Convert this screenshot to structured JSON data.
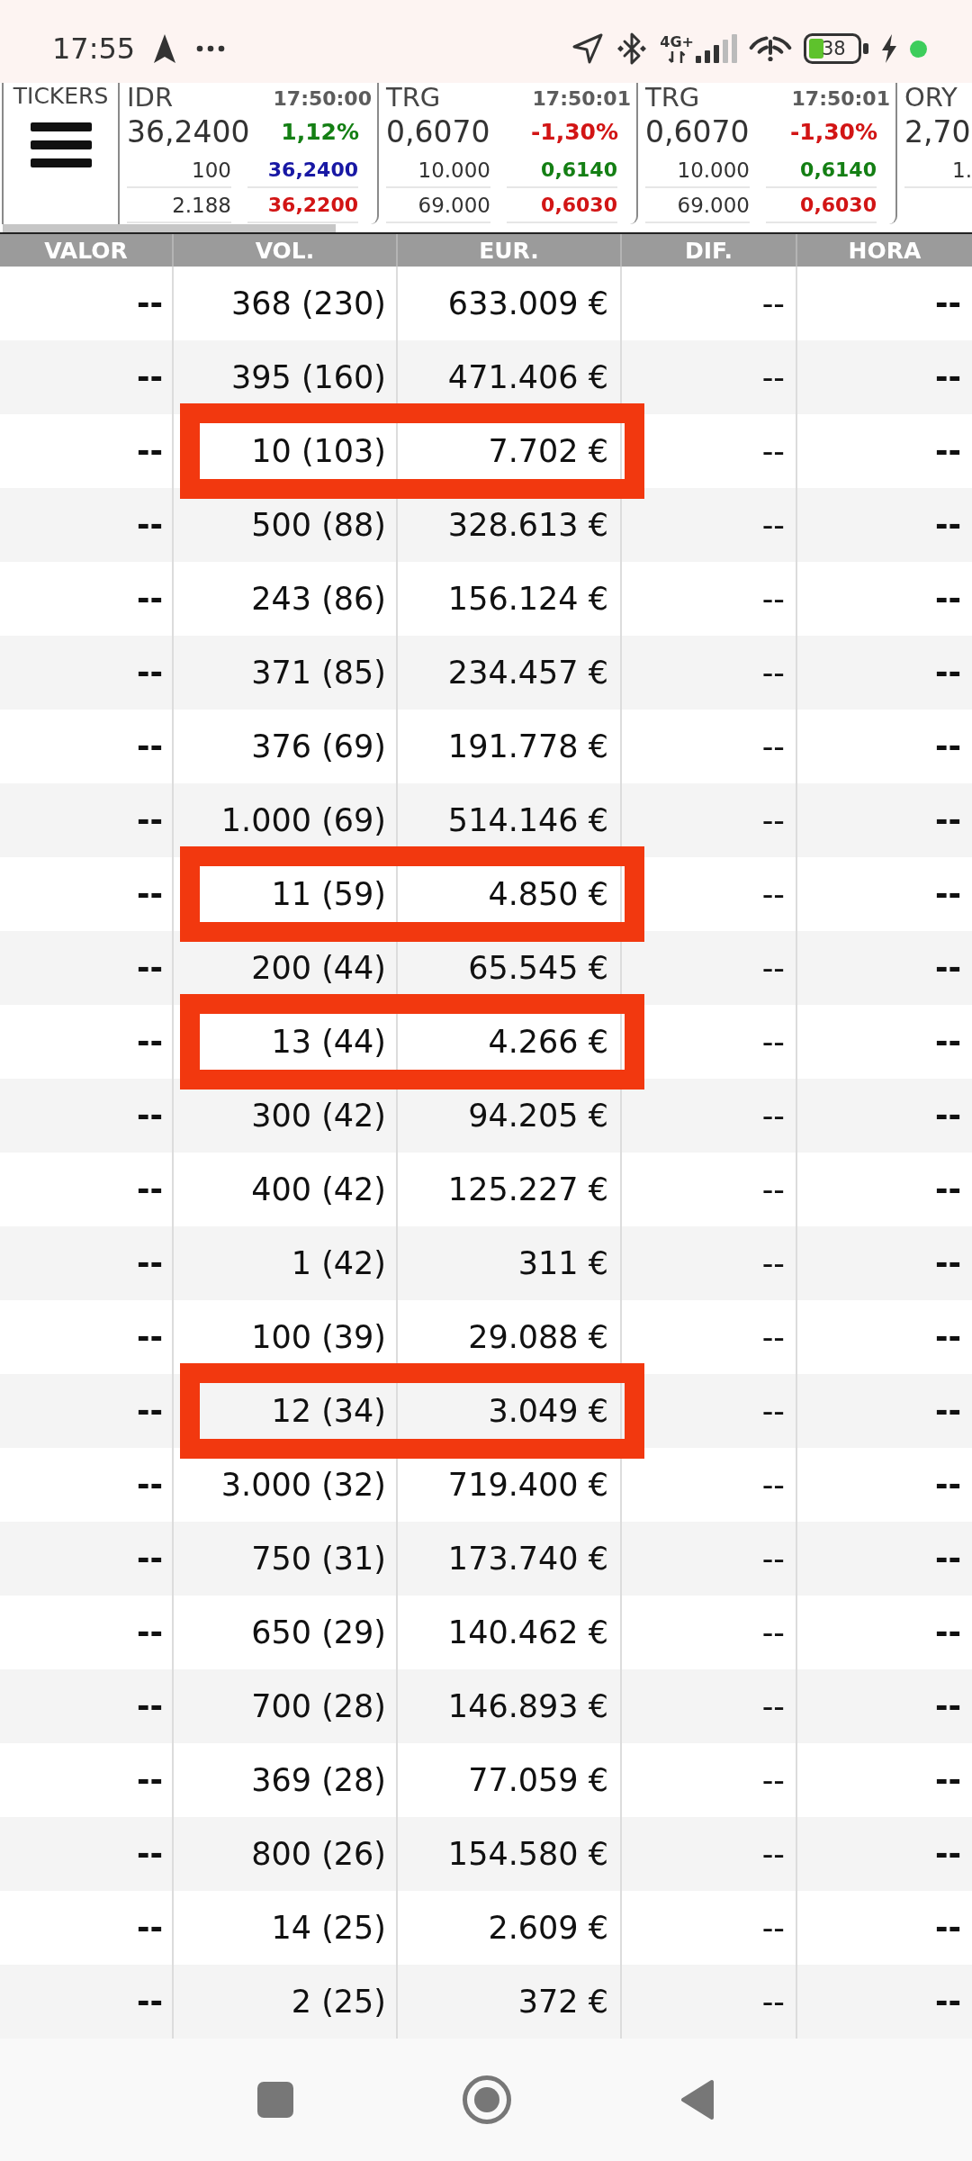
{
  "status_bar": {
    "time": "17:55",
    "network": "4G+",
    "battery": "38"
  },
  "tickers": {
    "label": "TICKERS",
    "items": [
      {
        "symbol": "IDR",
        "time": "17:50:00",
        "price": "36,2400",
        "change": {
          "text": "1,12%",
          "color": "#147f14"
        },
        "quotes": [
          {
            "volume": "100",
            "price": "36,2400",
            "color": "#1818a4"
          },
          {
            "volume": "2.188",
            "price": "36,2200",
            "color": "#d21515"
          }
        ]
      },
      {
        "symbol": "TRG",
        "time": "17:50:01",
        "price": "0,6070",
        "change": {
          "text": "-1,30%",
          "color": "#d21515"
        },
        "quotes": [
          {
            "volume": "10.000",
            "price": "0,6140",
            "color": "#147f14"
          },
          {
            "volume": "69.000",
            "price": "0,6030",
            "color": "#d21515"
          }
        ]
      },
      {
        "symbol": "TRG",
        "time": "17:50:01",
        "price": "0,6070",
        "change": {
          "text": "-1,30%",
          "color": "#d21515"
        },
        "quotes": [
          {
            "volume": "10.000",
            "price": "0,6140",
            "color": "#147f14"
          },
          {
            "volume": "69.000",
            "price": "0,6030",
            "color": "#d21515"
          }
        ]
      },
      {
        "symbol": "ORY",
        "price": "2,70",
        "quotes": [
          {
            "volume": "1."
          }
        ]
      }
    ]
  },
  "table": {
    "columns": [
      "VALOR",
      "VOL.",
      "EUR.",
      "DIF.",
      "HORA"
    ],
    "rows": [
      {
        "cells": [
          "--",
          "368 (230)",
          "633.009 €",
          "--",
          "--"
        ],
        "highlighted": false
      },
      {
        "cells": [
          "--",
          "395 (160)",
          "471.406 €",
          "--",
          "--"
        ],
        "highlighted": false
      },
      {
        "cells": [
          "--",
          "10 (103)",
          "7.702 €",
          "--",
          "--"
        ],
        "highlighted": true
      },
      {
        "cells": [
          "--",
          "500 (88)",
          "328.613 €",
          "--",
          "--"
        ],
        "highlighted": false
      },
      {
        "cells": [
          "--",
          "243 (86)",
          "156.124 €",
          "--",
          "--"
        ],
        "highlighted": false
      },
      {
        "cells": [
          "--",
          "371 (85)",
          "234.457 €",
          "--",
          "--"
        ],
        "highlighted": false
      },
      {
        "cells": [
          "--",
          "376 (69)",
          "191.778 €",
          "--",
          "--"
        ],
        "highlighted": false
      },
      {
        "cells": [
          "--",
          "1.000 (69)",
          "514.146 €",
          "--",
          "--"
        ],
        "highlighted": false
      },
      {
        "cells": [
          "--",
          "11 (59)",
          "4.850 €",
          "--",
          "--"
        ],
        "highlighted": true
      },
      {
        "cells": [
          "--",
          "200 (44)",
          "65.545 €",
          "--",
          "--"
        ],
        "highlighted": false
      },
      {
        "cells": [
          "--",
          "13 (44)",
          "4.266 €",
          "--",
          "--"
        ],
        "highlighted": true
      },
      {
        "cells": [
          "--",
          "300 (42)",
          "94.205 €",
          "--",
          "--"
        ],
        "highlighted": false
      },
      {
        "cells": [
          "--",
          "400 (42)",
          "125.227 €",
          "--",
          "--"
        ],
        "highlighted": false
      },
      {
        "cells": [
          "--",
          "1 (42)",
          "311 €",
          "--",
          "--"
        ],
        "highlighted": false
      },
      {
        "cells": [
          "--",
          "100 (39)",
          "29.088 €",
          "--",
          "--"
        ],
        "highlighted": false
      },
      {
        "cells": [
          "--",
          "12 (34)",
          "3.049 €",
          "--",
          "--"
        ],
        "highlighted": true
      },
      {
        "cells": [
          "--",
          "3.000 (32)",
          "719.400 €",
          "--",
          "--"
        ],
        "highlighted": false
      },
      {
        "cells": [
          "--",
          "750 (31)",
          "173.740 €",
          "--",
          "--"
        ],
        "highlighted": false
      },
      {
        "cells": [
          "--",
          "650 (29)",
          "140.462 €",
          "--",
          "--"
        ],
        "highlighted": false
      },
      {
        "cells": [
          "--",
          "700 (28)",
          "146.893 €",
          "--",
          "--"
        ],
        "highlighted": false
      },
      {
        "cells": [
          "--",
          "369 (28)",
          "77.059 €",
          "--",
          "--"
        ],
        "highlighted": false
      },
      {
        "cells": [
          "--",
          "800 (26)",
          "154.580 €",
          "--",
          "--"
        ],
        "highlighted": false
      },
      {
        "cells": [
          "--",
          "14 (25)",
          "2.609 €",
          "--",
          "--"
        ],
        "highlighted": false
      },
      {
        "cells": [
          "--",
          "2 (25)",
          "372 €",
          "--",
          "--"
        ],
        "highlighted": false
      }
    ]
  }
}
